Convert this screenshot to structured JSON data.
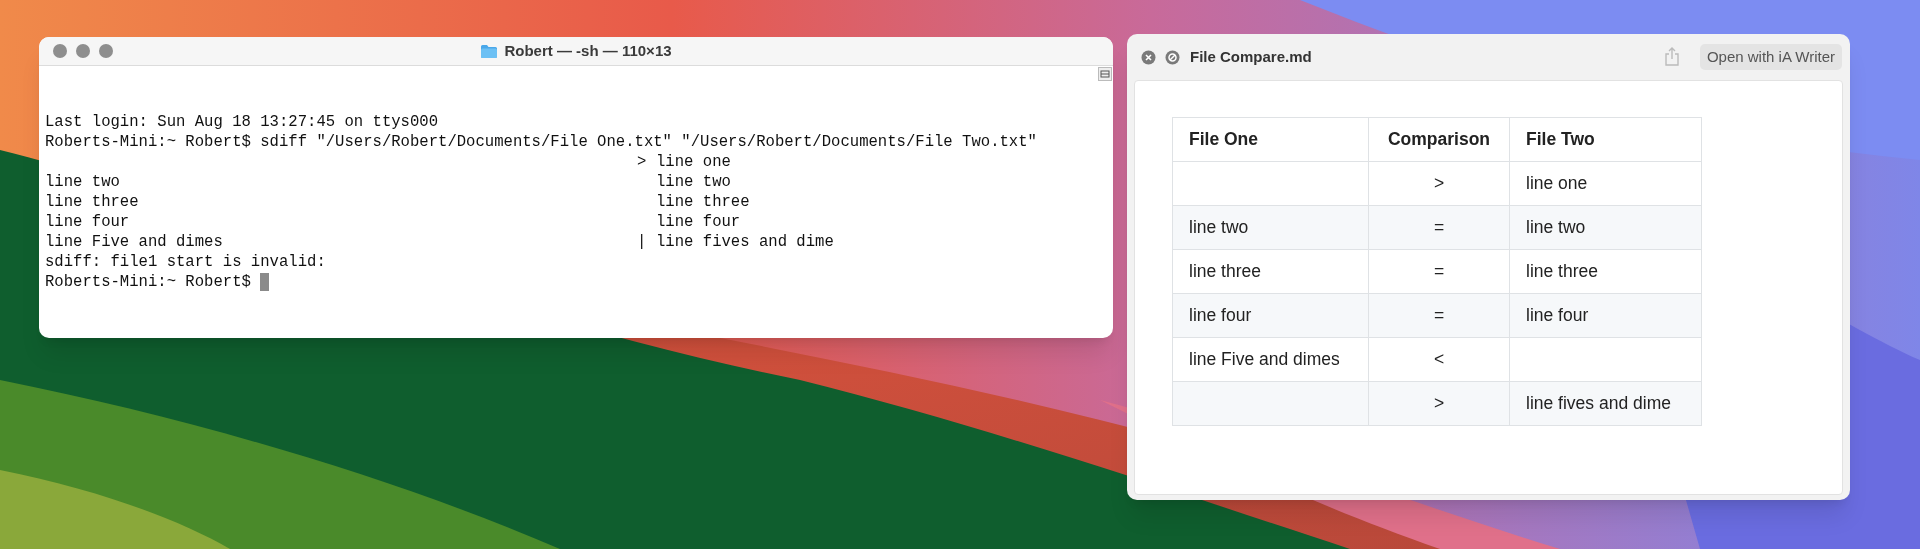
{
  "terminal": {
    "title": "Robert — -sh — 110×13",
    "lines": [
      "Last login: Sun Aug 18 13:27:45 on ttys000",
      "Roberts-Mini:~ Robert$ sdiff \"/Users/Robert/Documents/File One.txt\" \"/Users/Robert/Documents/File Two.txt\""
    ],
    "diff_rows": [
      {
        "left": "",
        "marker": ">",
        "right": "line one"
      },
      {
        "left": "line two",
        "marker": "",
        "right": "line two"
      },
      {
        "left": "line three",
        "marker": "",
        "right": "line three"
      },
      {
        "left": "line four",
        "marker": "",
        "right": "line four"
      },
      {
        "left": "line Five and dimes",
        "marker": "|",
        "right": "line fives and dime"
      }
    ],
    "after_lines": [
      "sdiff: file1 start is invalid:"
    ],
    "prompt": "Roberts-Mini:~ Robert$"
  },
  "preview": {
    "title": "File Compare.md",
    "open_button": "Open with iA Writer",
    "table": {
      "columns": [
        "File One",
        "Comparison",
        "File Two"
      ],
      "rows": [
        [
          "",
          ">",
          "line one"
        ],
        [
          "line two",
          "=",
          "line two"
        ],
        [
          "line three",
          "=",
          "line three"
        ],
        [
          "line four",
          "=",
          "line four"
        ],
        [
          "line Five and dimes",
          "<",
          ""
        ],
        [
          "",
          ">",
          "line fives and dime"
        ]
      ]
    }
  }
}
